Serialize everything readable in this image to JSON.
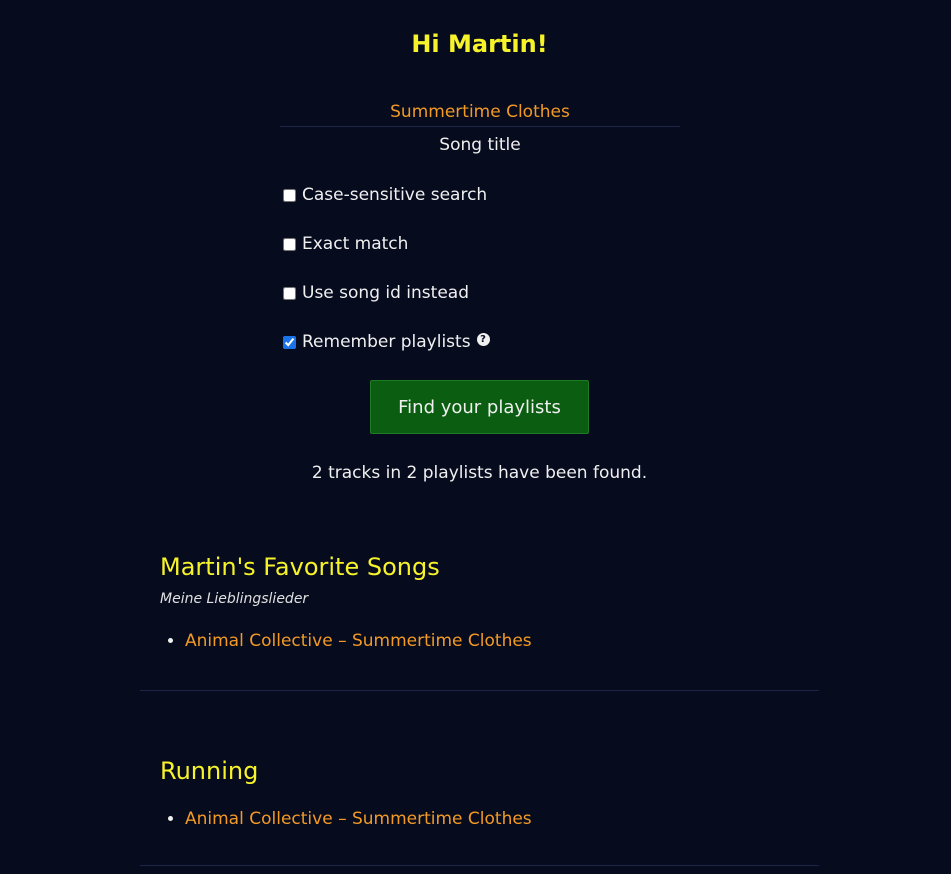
{
  "header": {
    "greeting": "Hi Martin!"
  },
  "search": {
    "song_value": "Summertime Clothes",
    "song_label": "Song title",
    "options": [
      {
        "label": "Case-sensitive search",
        "checked": false
      },
      {
        "label": "Exact match",
        "checked": false
      },
      {
        "label": "Use song id instead",
        "checked": false
      },
      {
        "label": "Remember playlists",
        "checked": true
      }
    ],
    "help_icon_glyph": "?",
    "submit_label": "Find your playlists"
  },
  "results": {
    "summary": "2 tracks in 2 playlists have been found.",
    "playlists": [
      {
        "title": "Martin's Favorite Songs",
        "description": "Meine Lieblingslieder",
        "tracks": [
          "Animal Collective – Summertime Clothes"
        ]
      },
      {
        "title": "Running",
        "description": "",
        "tracks": [
          "Animal Collective – Summertime Clothes"
        ]
      }
    ]
  },
  "colors": {
    "background": "#060b1e",
    "heading": "#f7f32a",
    "link": "#f39a25",
    "button": "#0b5e11",
    "checkbox_accent": "#1a73e8"
  },
  "icons": {
    "help": "help-icon"
  }
}
